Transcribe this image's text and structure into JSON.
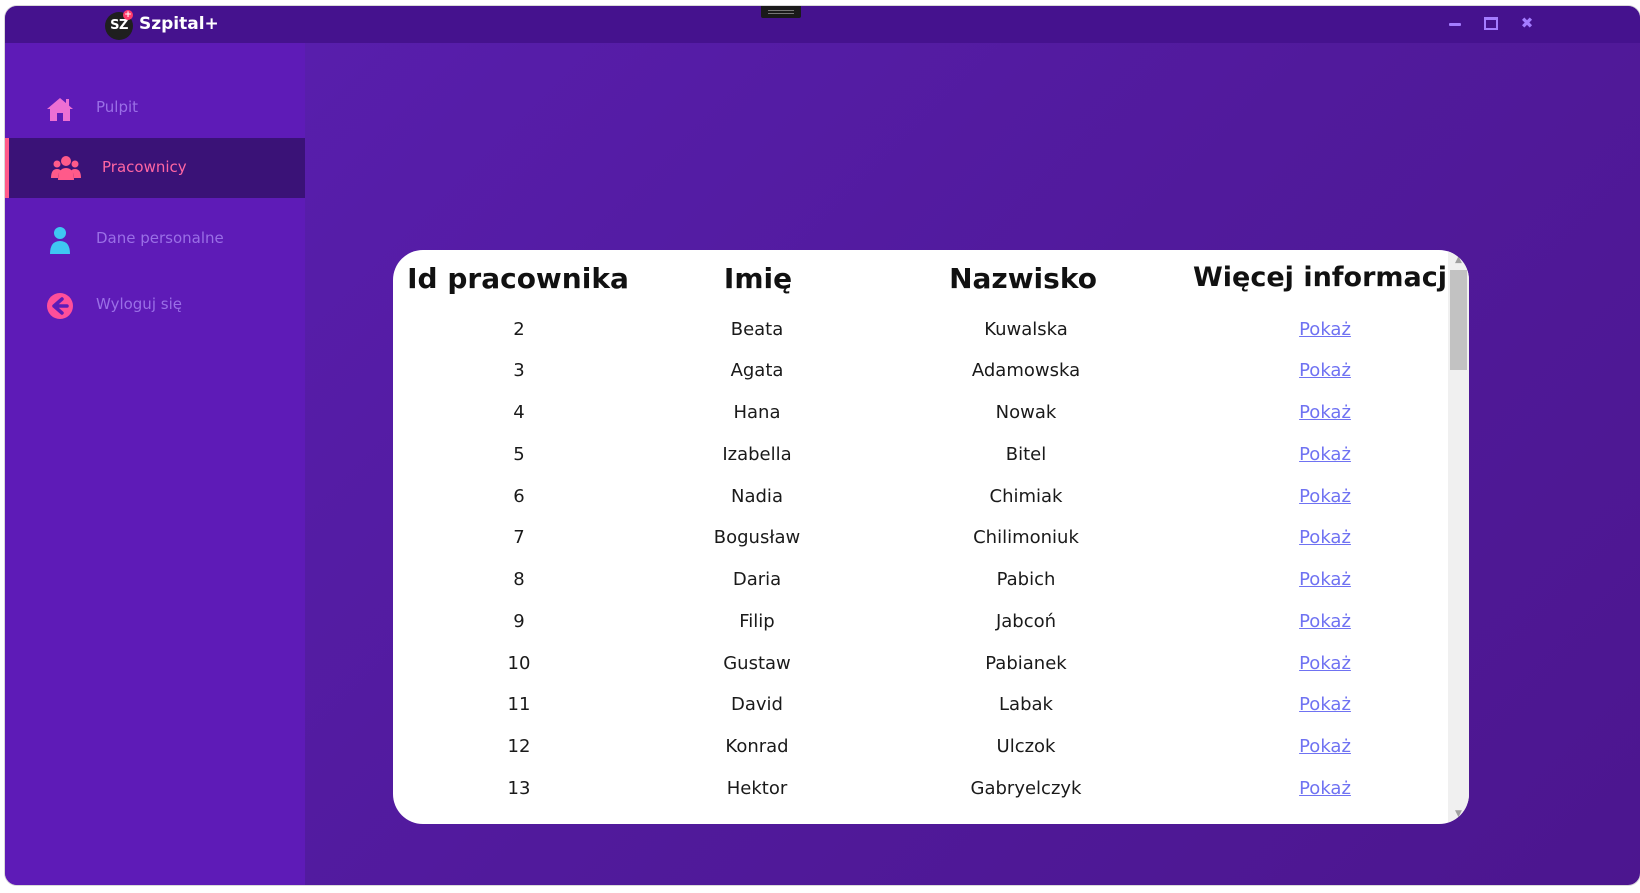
{
  "app": {
    "logo_text": "SZ",
    "logo_plus": "+",
    "title": "Szpital+"
  },
  "window_controls": {
    "minimize_icon": "minimize-icon",
    "maximize_icon": "maximize-icon",
    "close_icon": "close-icon",
    "close_glyph": "✖"
  },
  "sidebar": {
    "items": [
      {
        "label": "Pulpit",
        "icon": "home-icon",
        "active": false
      },
      {
        "label": "Pracownicy",
        "icon": "users-icon",
        "active": true
      },
      {
        "label": "Dane personalne",
        "icon": "user-icon",
        "active": false
      },
      {
        "label": "Wyloguj się",
        "icon": "logout-icon",
        "active": false
      }
    ]
  },
  "table": {
    "headers": [
      "Id pracownika",
      "Imię",
      "Nazwisko",
      "Więcej informacji"
    ],
    "rows": [
      {
        "id": "2",
        "name": "Beata",
        "surname": "Kuwalska",
        "link": "Pokaż"
      },
      {
        "id": "3",
        "name": "Agata",
        "surname": "Adamowska",
        "link": "Pokaż"
      },
      {
        "id": "4",
        "name": "Hana",
        "surname": "Nowak",
        "link": "Pokaż"
      },
      {
        "id": "5",
        "name": "Izabella",
        "surname": "Bitel",
        "link": "Pokaż"
      },
      {
        "id": "6",
        "name": "Nadia",
        "surname": "Chimiak",
        "link": "Pokaż"
      },
      {
        "id": "7",
        "name": "Bogusław",
        "surname": "Chilimoniuk",
        "link": "Pokaż"
      },
      {
        "id": "8",
        "name": "Daria",
        "surname": "Pabich",
        "link": "Pokaż"
      },
      {
        "id": "9",
        "name": "Filip",
        "surname": "Jabcoń",
        "link": "Pokaż"
      },
      {
        "id": "10",
        "name": "Gustaw",
        "surname": "Pabianek",
        "link": "Pokaż"
      },
      {
        "id": "11",
        "name": "David",
        "surname": "Labak",
        "link": "Pokaż"
      },
      {
        "id": "12",
        "name": "Konrad",
        "surname": "Ulczok",
        "link": "Pokaż"
      },
      {
        "id": "13",
        "name": "Hektor",
        "surname": "Gabryelczyk",
        "link": "Pokaż"
      }
    ]
  },
  "scrollbar": {
    "up_arrow": "▲",
    "down_arrow": "▼"
  },
  "colors": {
    "accent_pink": "#ff5a8a",
    "link_blue": "#6f72f2",
    "sidebar_bg": "#5e1bb7",
    "active_bg": "#3a1277"
  }
}
